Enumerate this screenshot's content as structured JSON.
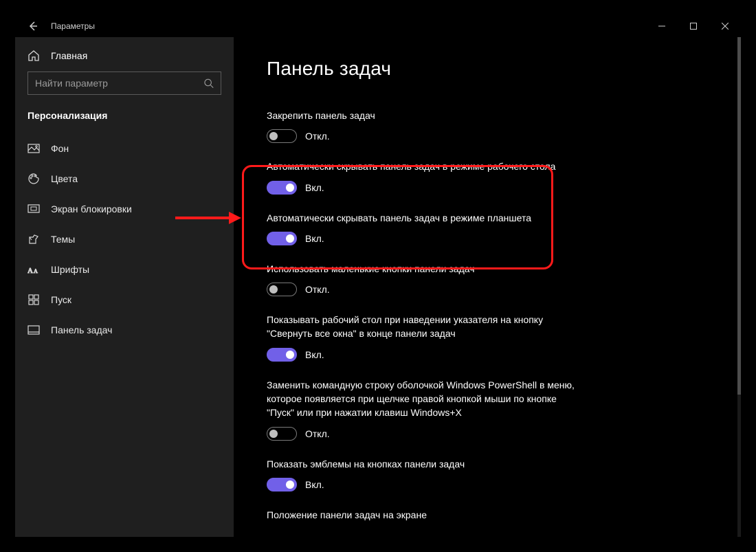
{
  "window": {
    "title": "Параметры"
  },
  "sidebar": {
    "home": "Главная",
    "search_placeholder": "Найти параметр",
    "category": "Персонализация",
    "items": [
      {
        "label": "Фон"
      },
      {
        "label": "Цвета"
      },
      {
        "label": "Экран блокировки"
      },
      {
        "label": "Темы"
      },
      {
        "label": "Шрифты"
      },
      {
        "label": "Пуск"
      },
      {
        "label": "Панель задач"
      }
    ]
  },
  "page": {
    "title": "Панель задач",
    "labels": {
      "on": "Вкл.",
      "off": "Откл."
    },
    "settings": [
      {
        "label": "Закрепить панель задач",
        "state": "off"
      },
      {
        "label": "Автоматически скрывать панель задач в режиме рабочего стола",
        "state": "on"
      },
      {
        "label": "Автоматически скрывать панель задач в режиме планшета",
        "state": "on"
      },
      {
        "label": "Использовать маленькие кнопки панели задач",
        "state": "off"
      },
      {
        "label": "Показывать рабочий стол при наведении указателя на кнопку \"Свернуть все окна\" в конце панели задач",
        "state": "on"
      },
      {
        "label": "Заменить командную строку оболочкой Windows PowerShell в меню, которое появляется при щелчке правой кнопкой мыши по кнопке \"Пуск\" или при нажатии клавиш Windows+X",
        "state": "off"
      },
      {
        "label": "Показать эмблемы на кнопках панели задач",
        "state": "on"
      },
      {
        "label": "Положение панели задач на экране",
        "state": null
      }
    ]
  },
  "colors": {
    "accent": "#7160e8",
    "highlight": "#ff1a1a"
  }
}
